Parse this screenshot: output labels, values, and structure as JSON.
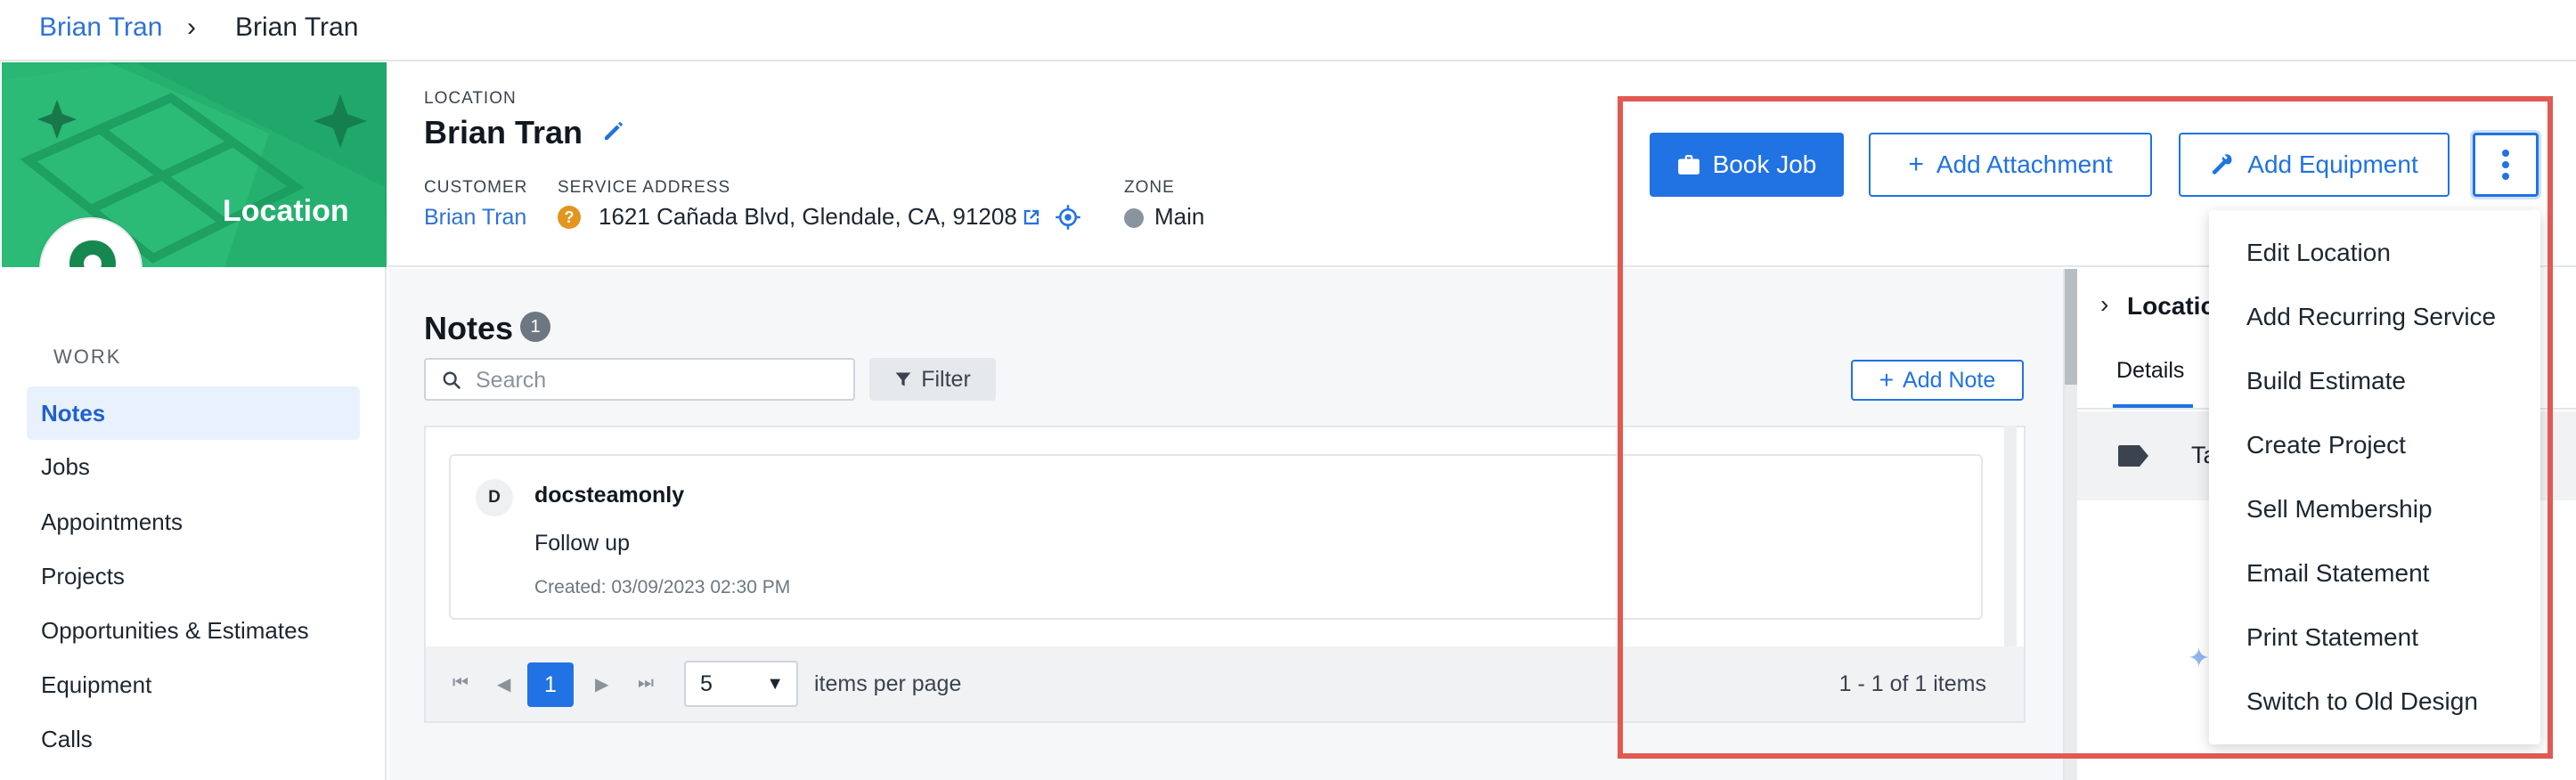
{
  "breadcrumb": {
    "parent": "Brian Tran",
    "separator": "›",
    "current": "Brian Tran"
  },
  "banner": {
    "title": "Location",
    "icon": "map-pin-icon"
  },
  "sidebar": {
    "section": "WORK",
    "items": [
      {
        "label": "Notes",
        "active": true
      },
      {
        "label": "Jobs"
      },
      {
        "label": "Appointments"
      },
      {
        "label": "Projects"
      },
      {
        "label": "Opportunities & Estimates"
      },
      {
        "label": "Equipment"
      },
      {
        "label": "Calls"
      }
    ]
  },
  "header": {
    "type_label": "LOCATION",
    "name": "Brian Tran",
    "customer_label": "CUSTOMER",
    "customer": "Brian Tran",
    "address_label": "SERVICE ADDRESS",
    "address": "1621 Cañada Blvd, Glendale, CA, 91208",
    "zone_label": "ZONE",
    "zone": "Main"
  },
  "actions": {
    "book_job": "Book Job",
    "add_attachment": "Add Attachment",
    "add_equipment": "Add Equipment"
  },
  "menu": {
    "items": [
      "Edit Location",
      "Add Recurring Service",
      "Build Estimate",
      "Create Project",
      "Sell Membership",
      "Email Statement",
      "Print Statement",
      "Switch to Old Design"
    ]
  },
  "notes": {
    "title": "Notes",
    "count": "1",
    "search_placeholder": "Search",
    "filter_label": "Filter",
    "add_note_label": "Add Note",
    "items": [
      {
        "avatar": "D",
        "author": "docsteamonly",
        "body": "Follow up",
        "created": "Created: 03/09/2023 02:30 PM"
      }
    ],
    "pager": {
      "current_page": "1",
      "page_size": "5",
      "items_per_page_label": "items per page",
      "range": "1 - 1 of 1 items"
    }
  },
  "right_panel": {
    "title": "Location",
    "tab": "Details",
    "tags_label": "Tags"
  },
  "colors": {
    "primary": "#2172e3",
    "banner": "#1fa86a",
    "highlight": "#e05a52"
  }
}
